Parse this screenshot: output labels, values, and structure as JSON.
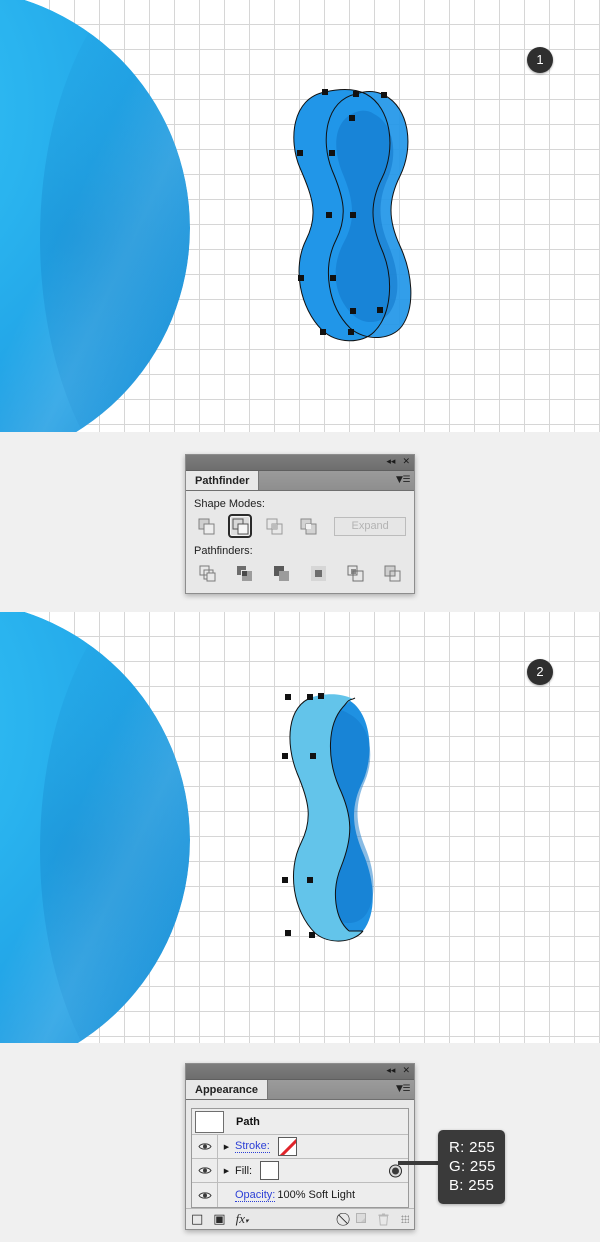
{
  "steps": [
    {
      "badge": "1"
    },
    {
      "badge": "2"
    }
  ],
  "pathfinder_panel": {
    "tab_label": "Pathfinder",
    "collapse_icon": "collapse-double-arrow-icon",
    "close_icon": "close-icon",
    "menu_icon": "panel-menu-icon",
    "shape_modes_label": "Shape Modes:",
    "pathfinders_label": "Pathfinders:",
    "expand_label": "Expand",
    "expand_enabled": false,
    "shape_modes": [
      {
        "name": "unite",
        "selected": false
      },
      {
        "name": "minus-front",
        "selected": true
      },
      {
        "name": "intersect",
        "selected": false
      },
      {
        "name": "exclude",
        "selected": false
      }
    ],
    "pathfinders": [
      {
        "name": "divide"
      },
      {
        "name": "trim"
      },
      {
        "name": "merge"
      },
      {
        "name": "crop"
      },
      {
        "name": "outline"
      },
      {
        "name": "minus-back"
      }
    ]
  },
  "appearance_panel": {
    "tab_label": "Appearance",
    "collapse_icon": "collapse-double-arrow-icon",
    "close_icon": "close-icon",
    "menu_icon": "panel-menu-icon",
    "target_label": "Path",
    "rows": [
      {
        "label": "Stroke:",
        "is_link": true,
        "swatch": "none",
        "has_arrow": true
      },
      {
        "label": "Fill:",
        "is_link": false,
        "swatch": "white",
        "has_arrow": true
      },
      {
        "label": "Opacity:",
        "is_link": true,
        "value": "100% Soft Light",
        "has_arrow": false
      }
    ],
    "footer_icons": [
      {
        "name": "add-new-stroke-icon",
        "glyph": "□",
        "enabled": true
      },
      {
        "name": "add-new-fill-icon",
        "glyph": "▣",
        "enabled": true
      },
      {
        "name": "add-new-effect-fx-icon",
        "glyph": "fx",
        "enabled": true
      },
      {
        "name": "clear-appearance-icon",
        "glyph": "⃠",
        "enabled": true
      },
      {
        "name": "duplicate-item-icon",
        "glyph": "⬒",
        "enabled": false
      },
      {
        "name": "delete-item-trash-icon",
        "glyph": "Ὕ1",
        "enabled": false
      }
    ]
  },
  "rgb_callout": {
    "r": "R: 255",
    "g": "G: 255",
    "b": "B: 255"
  },
  "colors": {
    "sphere_light": "#38c4f5",
    "sphere_mid": "#2ab4ef",
    "sphere_dark": "#1a8fd8",
    "shape_fill": "#2196e8",
    "shape_fill_light": "#63c4ea",
    "shape_shadow": "#1277c9",
    "badge_bg": "#2f2f2f",
    "callout_bg": "#3a3a3a",
    "grid_line": "#d6d6d6",
    "panel_bg": "#e8e8e8",
    "link_blue": "#2b3fd6",
    "stroke_none_red": "#e0242a"
  }
}
